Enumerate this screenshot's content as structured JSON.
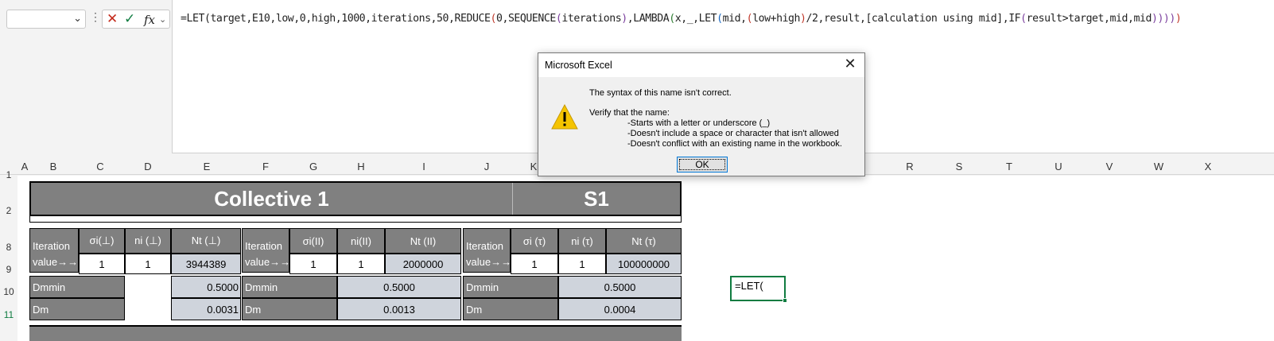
{
  "app": "Microsoft Excel",
  "formula_bar": {
    "name_box_value": "",
    "formula_parts": [
      {
        "t": "=LET(target,E10,low,0,high,1000,iterations,50,REDUCE",
        "c": ""
      },
      {
        "t": "(",
        "c": "fp1"
      },
      {
        "t": "0,SEQUENCE",
        "c": ""
      },
      {
        "t": "(",
        "c": "fp2"
      },
      {
        "t": "iterations",
        "c": ""
      },
      {
        "t": ")",
        "c": "fp2"
      },
      {
        "t": ",LAMBDA",
        "c": ""
      },
      {
        "t": "(",
        "c": "fp3"
      },
      {
        "t": "x,_,LET",
        "c": ""
      },
      {
        "t": "(",
        "c": "fp4"
      },
      {
        "t": "mid,",
        "c": ""
      },
      {
        "t": "(",
        "c": "fp1"
      },
      {
        "t": "low+high",
        "c": ""
      },
      {
        "t": ")",
        "c": "fp1"
      },
      {
        "t": "/2,result,[calculation using mid],IF",
        "c": ""
      },
      {
        "t": "(",
        "c": "fp2"
      },
      {
        "t": "result>target,mid,mid",
        "c": ""
      },
      {
        "t": "))))",
        "c": "fp2"
      },
      {
        "t": ")",
        "c": "fp1"
      }
    ]
  },
  "columns": [
    "A",
    "B",
    "C",
    "D",
    "E",
    "F",
    "G",
    "H",
    "I",
    "J",
    "K",
    "R",
    "S",
    "T",
    "U",
    "V",
    "W",
    "X"
  ],
  "rows": [
    "1",
    "2",
    "8",
    "9",
    "10",
    "11"
  ],
  "sheet": {
    "collective_title": "Collective 1",
    "s1_title": "S1",
    "iteration_label_1": "Iteration",
    "iteration_label_2": "value→→",
    "groups": [
      {
        "h1": "σi(⊥)",
        "h2": "ni (⊥)",
        "h3": "Nt (⊥)",
        "v1": "1",
        "v2": "1",
        "v3": "3944389",
        "dmmin": "0.5000",
        "dm": "0.0031"
      },
      {
        "h1": "σi(II)",
        "h2": "ni(II)",
        "h3": "Nt (II)",
        "v1": "1",
        "v2": "1",
        "v3": "2000000",
        "dmmin": "0.5000",
        "dm": "0.0013"
      },
      {
        "h1": "σi (τ)",
        "h2": "ni (τ)",
        "h3": "Nt  (τ)",
        "v1": "1",
        "v2": "1",
        "v3": "100000000",
        "dmmin": "0.5000",
        "dm": "0.0004"
      }
    ],
    "dmmin_label": "Dmmin",
    "dm_label": "Dm",
    "active_cell_value": "=LET("
  },
  "dialog": {
    "title": "Microsoft Excel",
    "line1": "The syntax of this name isn't correct.",
    "line2": "Verify that the name:",
    "rule1": "-Starts with a letter or underscore (_)",
    "rule2": "-Doesn't include a space or character that isn't allowed",
    "rule3": "-Doesn't conflict with an existing name in the workbook.",
    "ok_label": "OK",
    "icon": "warning-icon"
  }
}
